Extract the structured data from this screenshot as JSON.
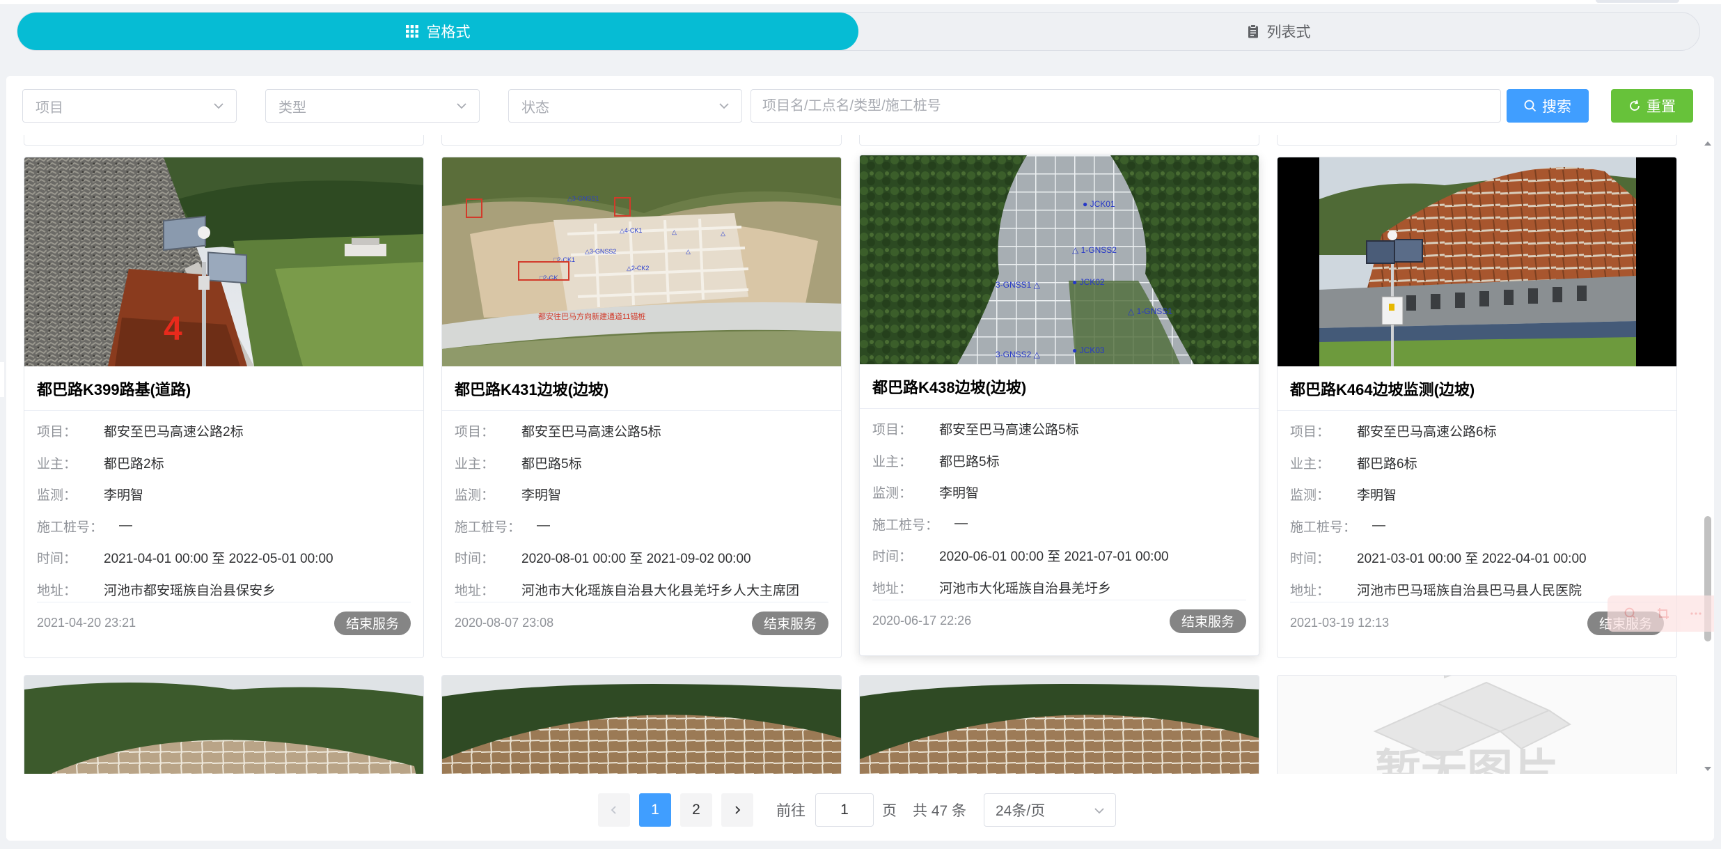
{
  "view_toggle": {
    "grid_label": "宫格式",
    "list_label": "列表式",
    "active": "grid"
  },
  "filters": {
    "project_placeholder": "项目",
    "type_placeholder": "类型",
    "status_placeholder": "状态",
    "search_placeholder": "项目名/工点名/类型/施工桩号",
    "search_label": "搜索",
    "reset_label": "重置"
  },
  "labels": {
    "project": "项目：",
    "owner": "业主：",
    "monitor": "监测：",
    "stake": "施工桩号：",
    "time": "时间：",
    "address": "地址："
  },
  "cards": [
    {
      "title": "都巴路K399路基(道路)",
      "project": "都安至巴马高速公路2标",
      "owner": "都巴路2标",
      "monitor": "李明智",
      "stake": "—",
      "time": "2021-04-01 00:00 至 2022-05-01 00:00",
      "address": "河池市都安瑶族自治县保安乡",
      "created": "2021-04-20 23:21",
      "status": "结束服务"
    },
    {
      "title": "都巴路K431边坡(边坡)",
      "project": "都安至巴马高速公路5标",
      "owner": "都巴路5标",
      "monitor": "李明智",
      "stake": "—",
      "time": "2020-08-01 00:00 至 2021-09-02 00:00",
      "address": "河池市大化瑶族自治县大化县羌圩乡人大主席团",
      "created": "2020-08-07 23:08",
      "status": "结束服务"
    },
    {
      "title": "都巴路K438边坡(边坡)",
      "project": "都安至巴马高速公路5标",
      "owner": "都巴路5标",
      "monitor": "李明智",
      "stake": "—",
      "time": "2020-06-01 00:00 至 2021-07-01 00:00",
      "address": "河池市大化瑶族自治县羌圩乡",
      "created": "2020-06-17 22:26",
      "status": "结束服务"
    },
    {
      "title": "都巴路K464边坡监测(边坡)",
      "project": "都安至巴马高速公路6标",
      "owner": "都巴路6标",
      "monitor": "李明智",
      "stake": "—",
      "time": "2021-03-01 00:00 至 2022-04-01 00:00",
      "address": "河池市巴马瑶族自治县巴马县人民医院",
      "created": "2021-03-19 12:13",
      "status": "结束服务"
    }
  ],
  "photo_labels": {
    "k431_caption": "都安往巴马方向新建通道11锚桩",
    "k438_points": [
      "JCK01",
      "1-GNSS2",
      "JCK02",
      "3-GNSS1",
      "1-GNSS1",
      "3-GNSS2",
      "JCK03"
    ],
    "placeholder_text": "暂无图片"
  },
  "pagination": {
    "pages": [
      "1",
      "2"
    ],
    "current": "1",
    "goto_prefix": "前往",
    "goto_value": "1",
    "goto_suffix": "页",
    "total": "共 47 条",
    "page_size": "24条/页"
  },
  "colors": {
    "accent": "#06bcd4",
    "search": "#409eff",
    "reset": "#67c23a",
    "tag": "#858585"
  }
}
